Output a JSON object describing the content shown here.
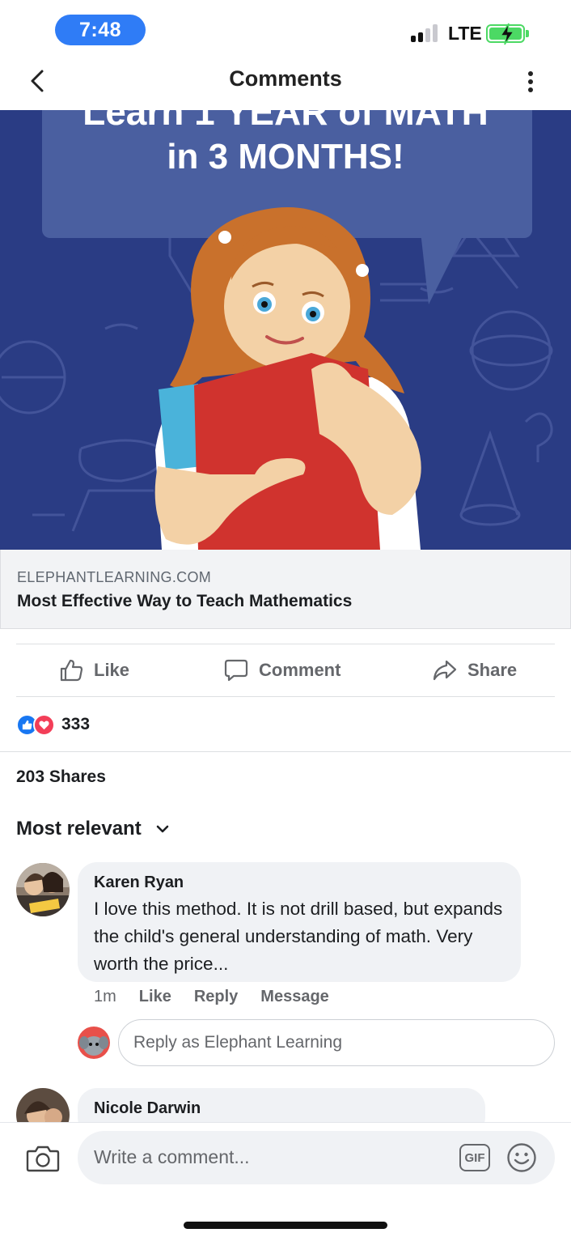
{
  "status_bar": {
    "time": "7:48",
    "network": "LTE",
    "signal_bars_active": 2,
    "signal_bars_total": 4,
    "battery_charging": true,
    "colors": {
      "time_pill": "#2f7cf6",
      "battery": "#4cd964"
    }
  },
  "header": {
    "title": "Comments",
    "back_icon": "chevron-left-icon",
    "more_icon": "more-vertical-icon"
  },
  "ad": {
    "image_text_line1": "Learn 1 YEAR of MATH",
    "image_text_line2": "in 3 MONTHS!",
    "domain": "ELEPHANTLEARNING.COM",
    "title": "Most Effective Way to Teach Mathematics",
    "colors": {
      "background": "#2a3c84",
      "banner": "#4a5fa0"
    }
  },
  "actions": {
    "like": "Like",
    "comment": "Comment",
    "share": "Share"
  },
  "reactions": {
    "count": "333",
    "types": [
      "like",
      "love"
    ],
    "colors": {
      "like": "#1877f2",
      "love": "#f33e58"
    }
  },
  "shares": "203 Shares",
  "sort": {
    "label": "Most relevant"
  },
  "comments": [
    {
      "author": "Karen Ryan",
      "text": "I love this method. It is not drill based, but expands the child's general understanding of math. Very worth the price...",
      "time": "1m",
      "actions": [
        "Like",
        "Reply",
        "Message"
      ]
    },
    {
      "author": "Nicole Darwin"
    }
  ],
  "reply": {
    "placeholder": "Reply as Elephant Learning"
  },
  "composer": {
    "placeholder": "Write a comment...",
    "gif_label": "GIF"
  }
}
